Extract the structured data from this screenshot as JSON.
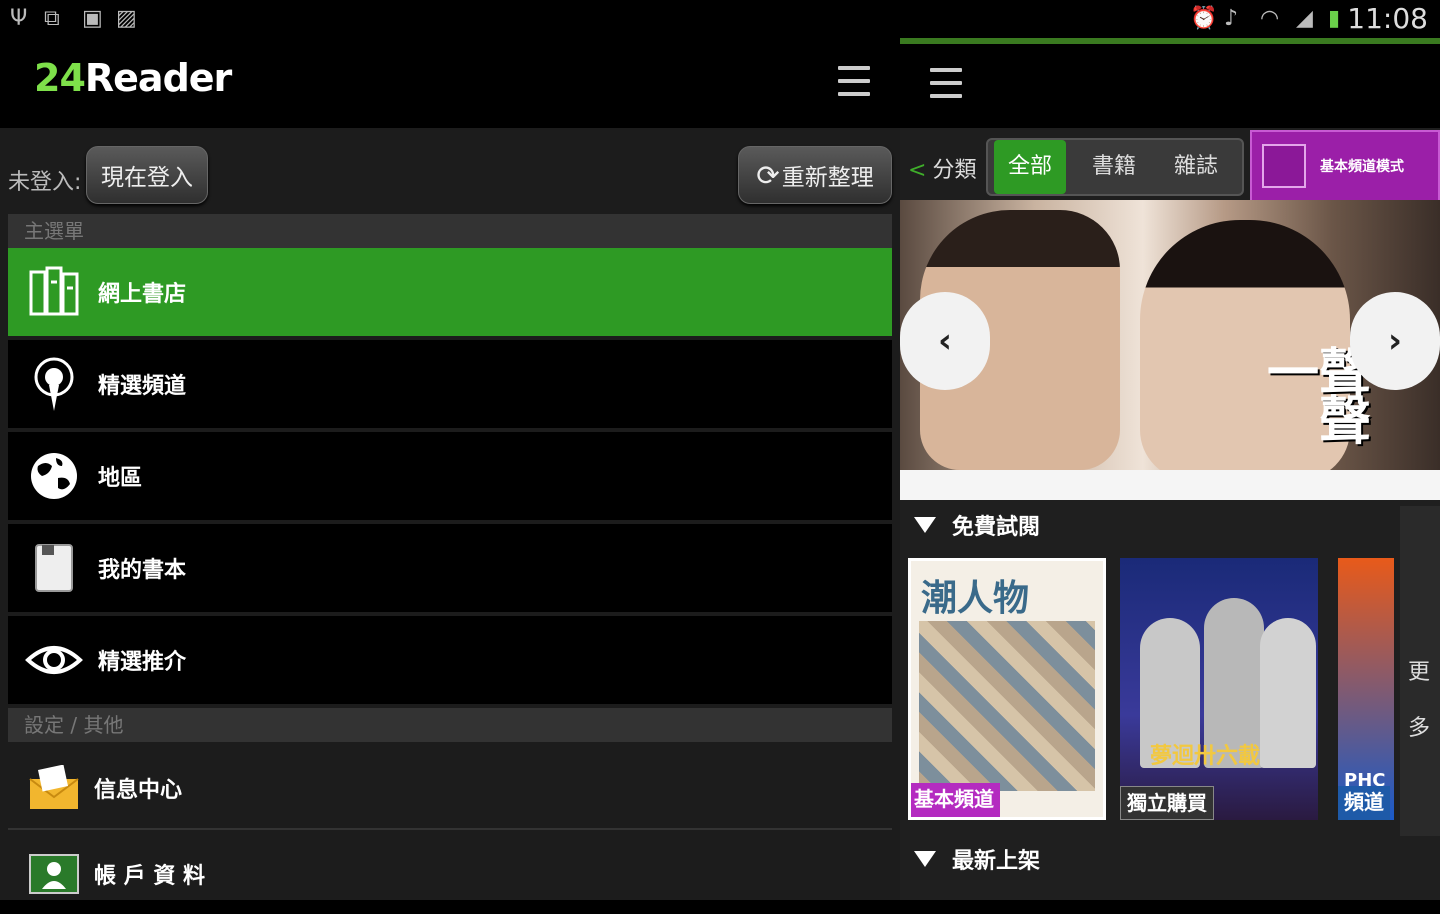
{
  "status_bar": {
    "time": "11:08",
    "icons": [
      "usb-icon",
      "screen-icon",
      "sd-icon",
      "image-icon",
      "alarm-icon",
      "mute-icon",
      "wifi-icon",
      "signal-icon",
      "battery-icon"
    ]
  },
  "app": {
    "logo_num": "24",
    "logo_text": "Reader"
  },
  "left_panel": {
    "not_logged_label": "未登入:",
    "login_button": "現在登入",
    "refresh_button": "重新整理",
    "section_main": "主選單",
    "menu": [
      {
        "label": "網上書店",
        "icon": "bookstore-icon",
        "active": true
      },
      {
        "label": "精選頻道",
        "icon": "podcast-icon",
        "active": false
      },
      {
        "label": "地區",
        "icon": "globe-icon",
        "active": false
      },
      {
        "label": "我的書本",
        "icon": "book-icon",
        "active": false
      },
      {
        "label": "精選推介",
        "icon": "eye-icon",
        "active": false
      }
    ],
    "section_settings": "設定 / 其他",
    "settings": [
      {
        "label": "信息中心",
        "icon": "mail-icon"
      },
      {
        "label": "帳 戶 資 料",
        "icon": "account-icon"
      }
    ]
  },
  "right_panel": {
    "back_label": "分類",
    "tabs": [
      "全部",
      "書籍",
      "雜誌"
    ],
    "active_tab": 0,
    "mode_button": "基本頻道模式",
    "banner_title": "一聲一聲",
    "free_section": "免費試閱",
    "new_section": "最新上架",
    "more_label": [
      "更",
      "多"
    ],
    "covers": [
      {
        "tag": "基本頻道",
        "tag_color": "#b42bc0",
        "title": "潮人物"
      },
      {
        "tag": "獨立購買",
        "tag_color": "#333333",
        "title": "夢迴卅六載"
      },
      {
        "tag": "頻道",
        "tag_color": "#1e5aa8",
        "title": "PHC"
      }
    ]
  },
  "colors": {
    "accent_green": "#2e9a24",
    "logo_green": "#7ee04a",
    "mode_purple": "#9b1fa8"
  }
}
